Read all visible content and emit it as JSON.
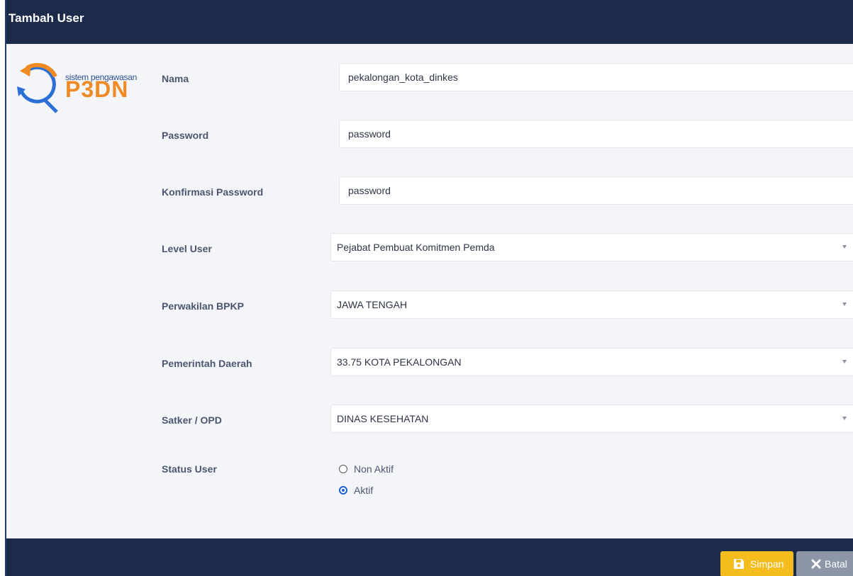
{
  "header": {
    "title": "Tambah User"
  },
  "logo": {
    "tagline": "sistem pengawasan",
    "name": "P3DN",
    "accent_color": "#f08a24",
    "blue_color": "#2c6fd6"
  },
  "form": {
    "nama": {
      "label": "Nama",
      "value": "pekalongan_kota_dinkes"
    },
    "password": {
      "label": "Password",
      "value": "password"
    },
    "confirm_password": {
      "label": "Konfirmasi Password",
      "value": "password"
    },
    "level_user": {
      "label": "Level User",
      "value": "Pejabat Pembuat Komitmen Pemda"
    },
    "perwakilan": {
      "label": "Perwakilan BPKP",
      "value": "JAWA TENGAH"
    },
    "pemda": {
      "label": "Pemerintah Daerah",
      "value": "33.75 KOTA PEKALONGAN"
    },
    "satker": {
      "label": "Satker / OPD",
      "value": "DINAS KESEHATAN"
    },
    "status": {
      "label": "Status User",
      "options": [
        {
          "label": "Non Aktif",
          "checked": false
        },
        {
          "label": "Aktif",
          "checked": true
        }
      ]
    }
  },
  "footer": {
    "save_label": "Simpan",
    "cancel_label": "Batal",
    "save_color": "#f4bc1c",
    "cancel_color": "#8c96a6"
  },
  "colors": {
    "header_bg": "#1c2b49",
    "body_bg": "#f4f5f8"
  }
}
